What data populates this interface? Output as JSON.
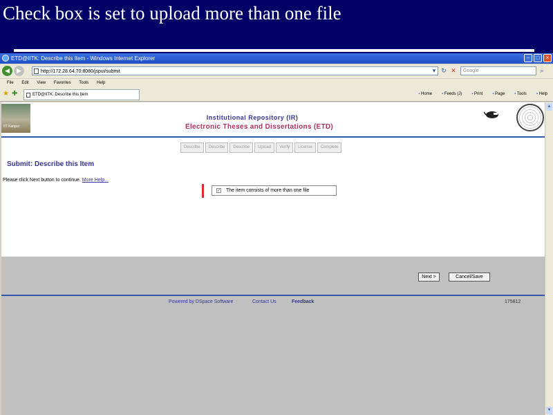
{
  "slide": {
    "title": "Check box is set to upload more than one file"
  },
  "browser": {
    "window_title": "ETD@IITK: Describe this Item - Windows Internet Explorer",
    "address": "http://172.28.64.70:8080/jspui/submit",
    "search_placeholder": "Google",
    "menu": [
      "File",
      "Edit",
      "View",
      "Favorites",
      "Tools",
      "Help"
    ],
    "tab_label": "ETD@IITK: Describe this Item",
    "commands": [
      "Home",
      "Feeds (J)",
      "Print",
      "Page",
      "Tools",
      "Help"
    ]
  },
  "page": {
    "logo_caption": "IIT Kanpur",
    "header_line1": "Institutional Repository (IR)",
    "header_line2": "Electronic Theses and Dissertations (ETD)",
    "steps": [
      "Describe",
      "Describe",
      "Describe",
      "Upload",
      "Verify",
      "License",
      "Complete"
    ],
    "heading": "Submit: Describe this Item",
    "hint": "Please click Next button to continue.",
    "more_help": "More Help...",
    "checkbox_label": "The item consists of more than one file",
    "checkbox_checked": true,
    "next_button": "Next >",
    "cancel_button": "Cancel/Save",
    "footer": {
      "powered": "Powered by DSpace Software",
      "contact": "Contact Us",
      "feedback": "Feedback",
      "counter": "175812"
    }
  }
}
